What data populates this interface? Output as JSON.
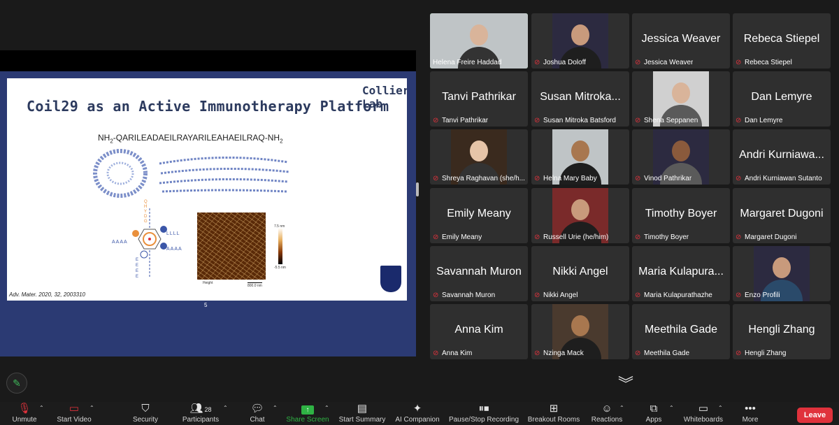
{
  "slide": {
    "title": "Coil29 as an Active Immunotherapy Platform",
    "logo_text": "Collier Lab",
    "sequence_prefix": "NH",
    "sequence_sub1": "2",
    "sequence_body": "-QARILEADAEILRAYARILEAHAEILRAQ-NH",
    "sequence_sub2": "2",
    "reference": "Adv. Mater. 2020, 32, 2003310",
    "page_number": "5",
    "scale_top": "7.5 nm",
    "scale_bottom": "-5.5 nm",
    "afm_label": "Height",
    "afm_bar": "800.0 nm",
    "wheel_left": "AAAA",
    "wheel_right_top": "LLLL",
    "wheel_right": "AAAA",
    "wheel_top": "QHYDG",
    "wheel_bottom": "EEEE"
  },
  "participants": [
    {
      "name": "Helena Freire Haddad",
      "display": "video",
      "active": true,
      "muted": false
    },
    {
      "name": "Joshua Doloff",
      "display": "video",
      "muted": true
    },
    {
      "name": "Jessica Weaver",
      "display": "name",
      "muted": true
    },
    {
      "name": "Rebeca Stiepel",
      "display": "name",
      "muted": true
    },
    {
      "name": "Tanvi Pathrikar",
      "display": "name",
      "muted": true
    },
    {
      "name": "Susan Mitroka Batsford",
      "big": "Susan Mitroka...",
      "display": "name",
      "muted": true
    },
    {
      "name": "Shena Seppanen",
      "display": "video",
      "muted": true
    },
    {
      "name": "Dan Lemyre",
      "display": "name",
      "muted": true
    },
    {
      "name": "Shreya Raghavan (she/h...",
      "display": "video",
      "muted": true
    },
    {
      "name": "Helna Mary Baby",
      "display": "video",
      "muted": true
    },
    {
      "name": "Vinod Pathrikar",
      "display": "video",
      "muted": true
    },
    {
      "name": "Andri Kurniawan Sutanto",
      "big": "Andri Kurniawa...",
      "display": "name",
      "muted": true
    },
    {
      "name": "Emily Meany",
      "display": "name",
      "muted": true
    },
    {
      "name": "Russell Urie (he/him)",
      "display": "video",
      "muted": true
    },
    {
      "name": "Timothy Boyer",
      "display": "name",
      "muted": true
    },
    {
      "name": "Margaret Dugoni",
      "display": "name",
      "muted": true
    },
    {
      "name": "Savannah Muron",
      "display": "name",
      "muted": true
    },
    {
      "name": "Nikki Angel",
      "display": "name",
      "muted": true
    },
    {
      "name": "Maria Kulapurathazhe",
      "big": "Maria Kulapura...",
      "display": "name",
      "muted": true
    },
    {
      "name": "Enzo Profili",
      "display": "video",
      "muted": true
    },
    {
      "name": "Anna Kim",
      "display": "name",
      "muted": true
    },
    {
      "name": "Nzinga Mack",
      "display": "video",
      "muted": true
    },
    {
      "name": "Meethila Gade",
      "display": "name",
      "muted": true
    },
    {
      "name": "Hengli Zhang",
      "display": "name",
      "muted": true
    }
  ],
  "toolbar": {
    "unmute": "Unmute",
    "start_video": "Start Video",
    "security": "Security",
    "participants": "Participants",
    "participant_count": "28",
    "chat": "Chat",
    "share_screen": "Share Screen",
    "start_summary": "Start Summary",
    "ai_companion": "AI Companion",
    "recording": "Pause/Stop Recording",
    "breakout_rooms": "Breakout Rooms",
    "reactions": "Reactions",
    "apps": "Apps",
    "whiteboards": "Whiteboards",
    "more": "More",
    "leave": "Leave"
  },
  "colors": {
    "active_speaker": "#33c14f",
    "muted_icon": "#e0323c",
    "share_green": "#2fb344",
    "leave_red": "#e0323c",
    "slide_frame": "#2b3a73"
  }
}
